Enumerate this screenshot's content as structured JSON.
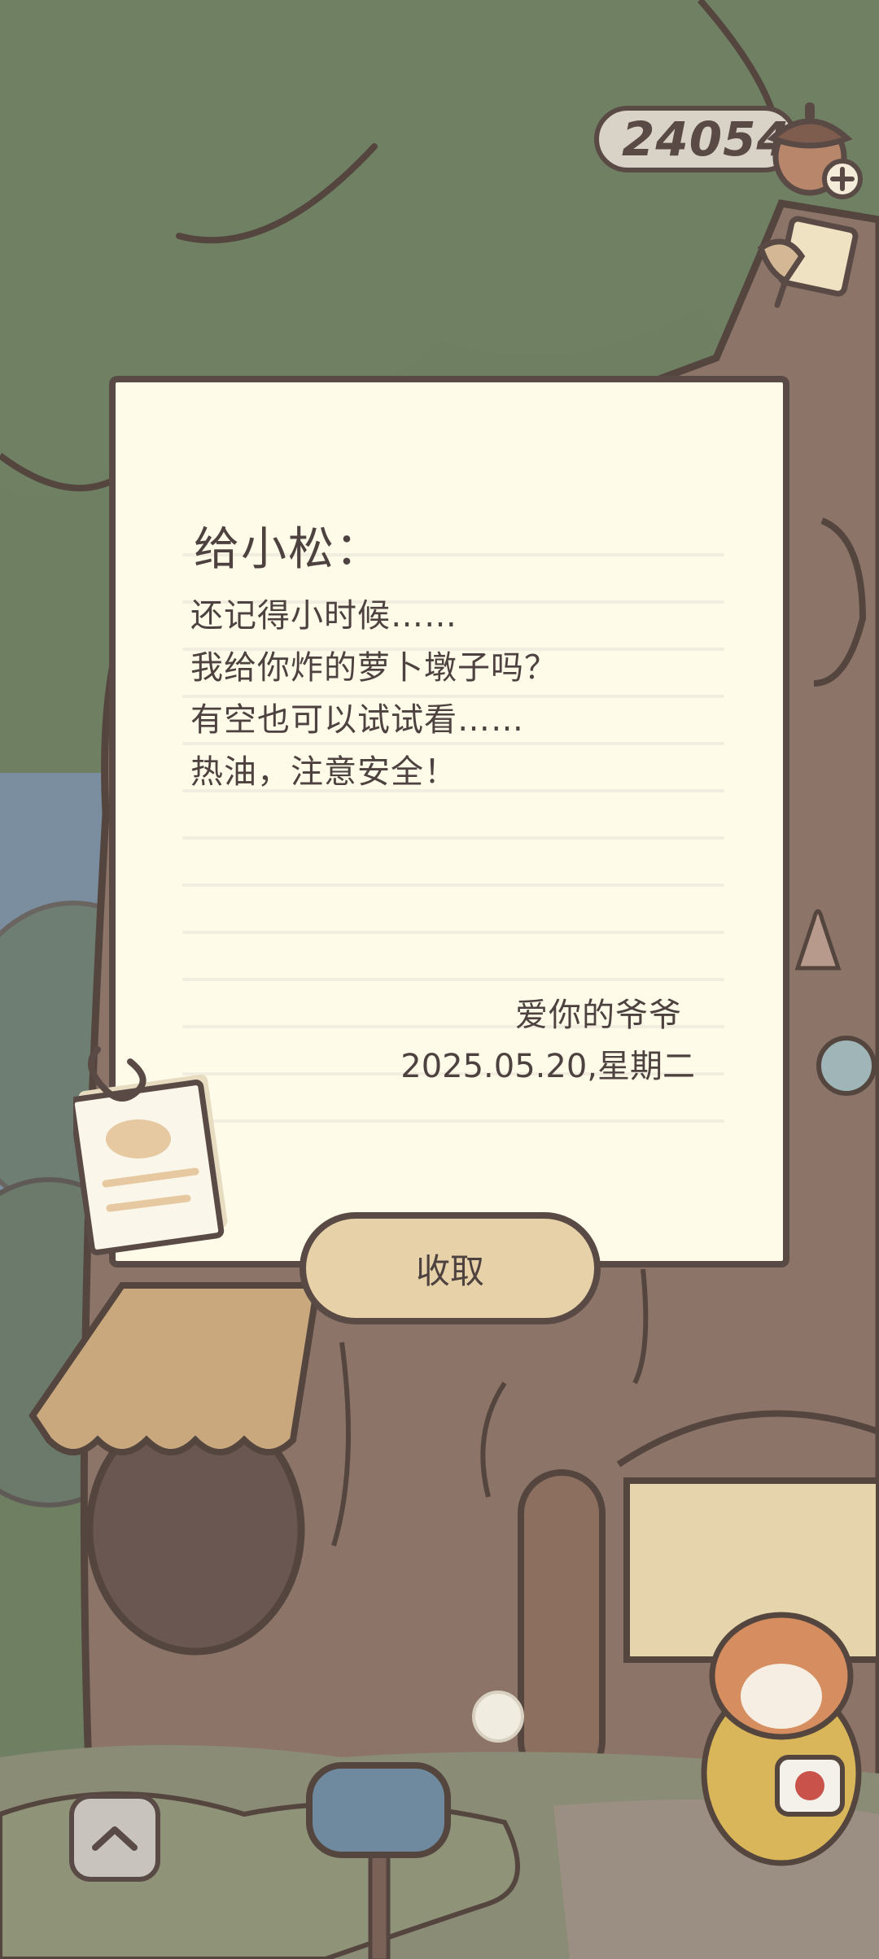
{
  "currency": {
    "acorns": "24054",
    "add_icon": "plus-icon"
  },
  "letter": {
    "salutation": "给小松：",
    "lines": [
      "还记得小时候……",
      "我给你炸的萝卜墩子吗？",
      "有空也可以试试看……",
      "热油，注意安全！"
    ],
    "signature": "爱你的爷爷",
    "date": "2025.05.20,星期二"
  },
  "actions": {
    "collect_label": "收取"
  },
  "icons": {
    "currency": "acorn-icon",
    "side": "pushpin-note-icon",
    "memo": "paperclip-note-icon",
    "expand": "chevron-up-icon"
  },
  "colors": {
    "outline": "#5a4a45",
    "paper": "#fefbe8",
    "button": "#e7d1a8",
    "canopy": "#6e7f62",
    "trunk": "#8c7468"
  }
}
